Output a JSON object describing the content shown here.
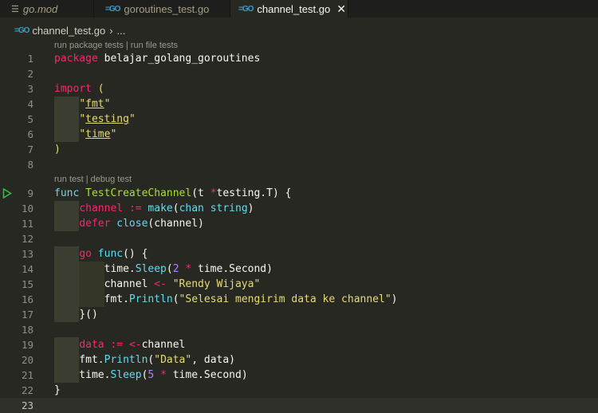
{
  "tabs": [
    {
      "label": "go.mod",
      "icon": "lines-icon",
      "active": false
    },
    {
      "label": "goroutines_test.go",
      "icon": "go-icon",
      "active": false
    },
    {
      "label": "channel_test.go",
      "icon": "go-icon",
      "active": true,
      "close": "✕"
    }
  ],
  "breadcrumb": {
    "file": "channel_test.go",
    "sep": "›",
    "rest": "..."
  },
  "lenses": {
    "file": "run package tests | run file tests",
    "func": "run test | debug test"
  },
  "lines": [
    {
      "n": "1",
      "tokens": [
        [
          "kw",
          "package"
        ],
        [
          "plain",
          " belajar_golang_goroutines"
        ]
      ]
    },
    {
      "n": "2",
      "tokens": []
    },
    {
      "n": "3",
      "tokens": [
        [
          "kw",
          "import"
        ],
        [
          "plain",
          " "
        ],
        [
          "str",
          "("
        ]
      ]
    },
    {
      "n": "4",
      "tokens": [
        [
          "plain",
          "    "
        ],
        [
          "str",
          "\""
        ],
        [
          "str ul",
          "fmt"
        ],
        [
          "str",
          "\""
        ]
      ]
    },
    {
      "n": "5",
      "tokens": [
        [
          "plain",
          "    "
        ],
        [
          "str",
          "\""
        ],
        [
          "str ul",
          "testing"
        ],
        [
          "str",
          "\""
        ]
      ]
    },
    {
      "n": "6",
      "tokens": [
        [
          "plain",
          "    "
        ],
        [
          "str",
          "\""
        ],
        [
          "str ul",
          "time"
        ],
        [
          "str",
          "\""
        ]
      ]
    },
    {
      "n": "7",
      "tokens": [
        [
          "str",
          ")"
        ]
      ]
    },
    {
      "n": "8",
      "tokens": []
    },
    {
      "n": "9",
      "tokens": [
        [
          "kwb",
          "func"
        ],
        [
          "plain",
          " "
        ],
        [
          "fn",
          "TestCreateChannel"
        ],
        [
          "plain",
          "(t "
        ],
        [
          "op",
          "*"
        ],
        [
          "plain",
          "testing.T) {"
        ]
      ]
    },
    {
      "n": "10",
      "tokens": [
        [
          "plain",
          "    "
        ],
        [
          "var",
          "channel"
        ],
        [
          "plain",
          " "
        ],
        [
          "op",
          ":="
        ],
        [
          "plain",
          " "
        ],
        [
          "kwb",
          "make"
        ],
        [
          "plain",
          "("
        ],
        [
          "ty",
          "chan"
        ],
        [
          "plain",
          " "
        ],
        [
          "ty",
          "string"
        ],
        [
          "plain",
          ")"
        ]
      ]
    },
    {
      "n": "11",
      "tokens": [
        [
          "plain",
          "    "
        ],
        [
          "kw",
          "defer"
        ],
        [
          "plain",
          " "
        ],
        [
          "kwb",
          "close"
        ],
        [
          "plain",
          "(channel)"
        ]
      ]
    },
    {
      "n": "12",
      "tokens": []
    },
    {
      "n": "13",
      "tokens": [
        [
          "plain",
          "    "
        ],
        [
          "kw",
          "go"
        ],
        [
          "plain",
          " "
        ],
        [
          "kwb",
          "func"
        ],
        [
          "plain",
          "() {"
        ]
      ]
    },
    {
      "n": "14",
      "tokens": [
        [
          "plain",
          "        time."
        ],
        [
          "kwb",
          "Sleep"
        ],
        [
          "plain",
          "("
        ],
        [
          "num",
          "2"
        ],
        [
          "plain",
          " "
        ],
        [
          "op",
          "*"
        ],
        [
          "plain",
          " time.Second)"
        ]
      ]
    },
    {
      "n": "15",
      "tokens": [
        [
          "plain",
          "        channel "
        ],
        [
          "op",
          "<-"
        ],
        [
          "plain",
          " "
        ],
        [
          "str",
          "\"Rendy Wijaya\""
        ]
      ]
    },
    {
      "n": "16",
      "tokens": [
        [
          "plain",
          "        fmt."
        ],
        [
          "kwb",
          "Println"
        ],
        [
          "plain",
          "("
        ],
        [
          "str",
          "\"Selesai mengirim data ke channel\""
        ],
        [
          "plain",
          ")"
        ]
      ]
    },
    {
      "n": "17",
      "tokens": [
        [
          "plain",
          "    "
        ],
        [
          "plain",
          "}()"
        ]
      ]
    },
    {
      "n": "18",
      "tokens": []
    },
    {
      "n": "19",
      "tokens": [
        [
          "plain",
          "    "
        ],
        [
          "var",
          "data"
        ],
        [
          "plain",
          " "
        ],
        [
          "op",
          ":="
        ],
        [
          "plain",
          " "
        ],
        [
          "op",
          "<-"
        ],
        [
          "plain",
          "channel"
        ]
      ]
    },
    {
      "n": "20",
      "tokens": [
        [
          "plain",
          "    fmt."
        ],
        [
          "kwb",
          "Println"
        ],
        [
          "plain",
          "("
        ],
        [
          "str",
          "\"Data\""
        ],
        [
          "plain",
          ", data)"
        ]
      ]
    },
    {
      "n": "21",
      "tokens": [
        [
          "plain",
          "    time."
        ],
        [
          "kwb",
          "Sleep"
        ],
        [
          "plain",
          "("
        ],
        [
          "num",
          "5"
        ],
        [
          "plain",
          " "
        ],
        [
          "op",
          "*"
        ],
        [
          "plain",
          " time.Second)"
        ]
      ]
    },
    {
      "n": "22",
      "tokens": [
        [
          "plain",
          "}"
        ]
      ]
    },
    {
      "n": "23",
      "tokens": []
    }
  ],
  "colors": {
    "bg": "#272822",
    "tabbar": "#1e1f1c",
    "keyword": "#f92672",
    "function": "#a6e22e",
    "string": "#e6db74",
    "number": "#ae81ff",
    "builtin": "#66d9ef"
  }
}
